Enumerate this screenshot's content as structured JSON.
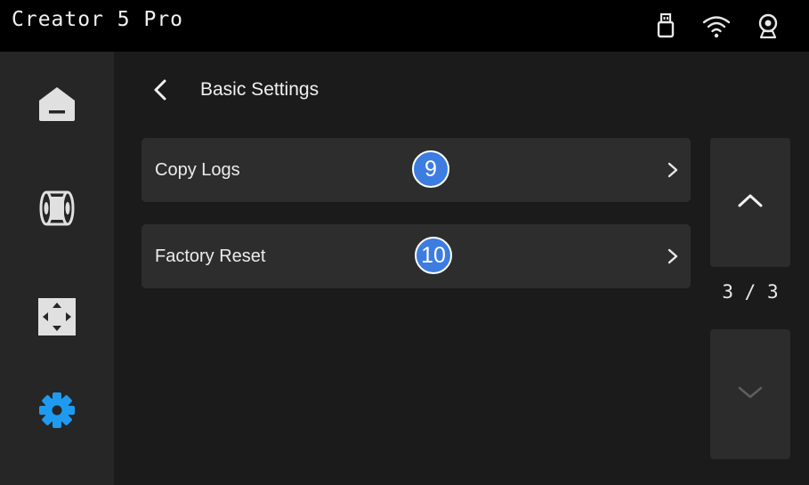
{
  "header": {
    "app_title": "Creator 5 Pro",
    "status_icons": [
      "usb-drive-icon",
      "wifi-icon",
      "camera-icon"
    ]
  },
  "sidebar": {
    "items": [
      {
        "name": "home",
        "icon": "home-icon",
        "active": false
      },
      {
        "name": "filament",
        "icon": "filament-spool-icon",
        "active": false
      },
      {
        "name": "move",
        "icon": "move-arrows-icon",
        "active": false
      },
      {
        "name": "settings",
        "icon": "gear-icon",
        "active": true
      }
    ],
    "active_color": "#1e9bf0"
  },
  "main": {
    "title": "Basic Settings",
    "rows": [
      {
        "label": "Copy Logs",
        "badge": "9"
      },
      {
        "label": "Factory Reset",
        "badge": "10"
      }
    ],
    "pagination": {
      "indicator": "3 / 3",
      "current": 3,
      "total": 3
    }
  },
  "colors": {
    "background": "#1b1b1b",
    "topbar": "#000000",
    "sidebar": "#262626",
    "row": "#2d2d2d",
    "badge": "#3d7ce0"
  }
}
